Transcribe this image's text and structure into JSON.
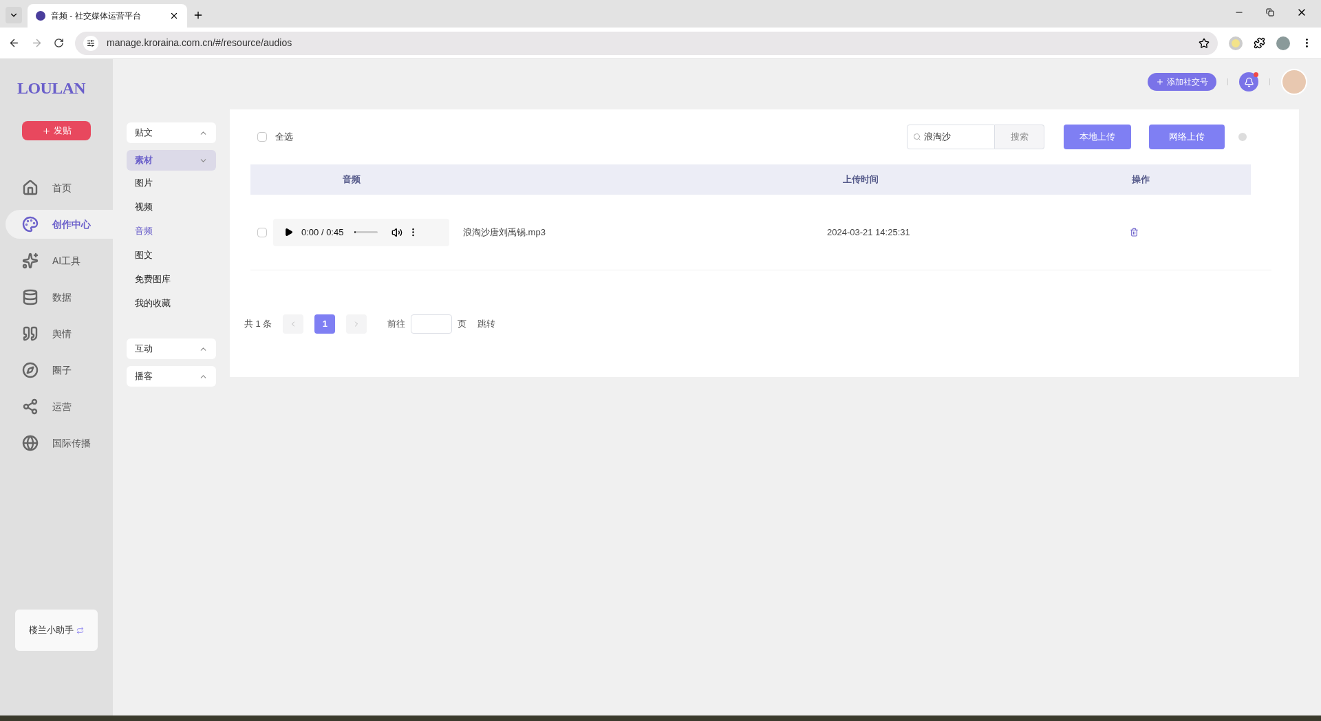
{
  "browser": {
    "tab_title": "音频 - 社交媒体运营平台",
    "url": "manage.kroraina.com.cn/#/resource/audios"
  },
  "sidebar": {
    "logo": "LOULAN",
    "post_button": "发贴",
    "nav": [
      {
        "label": "首页",
        "selected": false
      },
      {
        "label": "创作中心",
        "selected": true
      },
      {
        "label": "AI工具",
        "selected": false
      },
      {
        "label": "数据",
        "selected": false
      },
      {
        "label": "舆情",
        "selected": false
      },
      {
        "label": "圈子",
        "selected": false
      },
      {
        "label": "运营",
        "selected": false
      },
      {
        "label": "国际传播",
        "selected": false
      }
    ],
    "helper": "楼兰小助手"
  },
  "submenu": [
    {
      "label": "贴文",
      "expanded": false,
      "selected": false
    },
    {
      "label": "素材",
      "expanded": true,
      "selected": true,
      "children": [
        {
          "label": "图片",
          "selected": false
        },
        {
          "label": "视频",
          "selected": false
        },
        {
          "label": "音频",
          "selected": true
        },
        {
          "label": "图文",
          "selected": false
        },
        {
          "label": "免费图库",
          "selected": false
        },
        {
          "label": "我的收藏",
          "selected": false
        }
      ]
    },
    {
      "label": "互动",
      "expanded": false,
      "selected": false
    },
    {
      "label": "播客",
      "expanded": false,
      "selected": false
    }
  ],
  "header": {
    "add_account_button": "添加社交号",
    "notification_dot": true
  },
  "toolbar": {
    "select_all": {
      "label": "全选",
      "checked": false
    },
    "search": {
      "value": "浪淘沙"
    },
    "search_button": "搜索",
    "upload_buttons": [
      "本地上传",
      "网络上传"
    ]
  },
  "table": {
    "columns": [
      "音频",
      "上传时间",
      "操作"
    ],
    "rows": [
      {
        "checked": false,
        "player": {
          "time": "0:00 / 0:45",
          "level": 0.05
        },
        "filename": "浪淘沙唐刘禹锡.mp3",
        "uploaded": "2024-03-21 14:25:31"
      }
    ]
  },
  "pagination": {
    "total": "共 1 条",
    "pages": [
      {
        "label": "1",
        "selected": true
      }
    ],
    "goto_label": "前往",
    "page_unit": "页",
    "jump": "跳转"
  }
}
